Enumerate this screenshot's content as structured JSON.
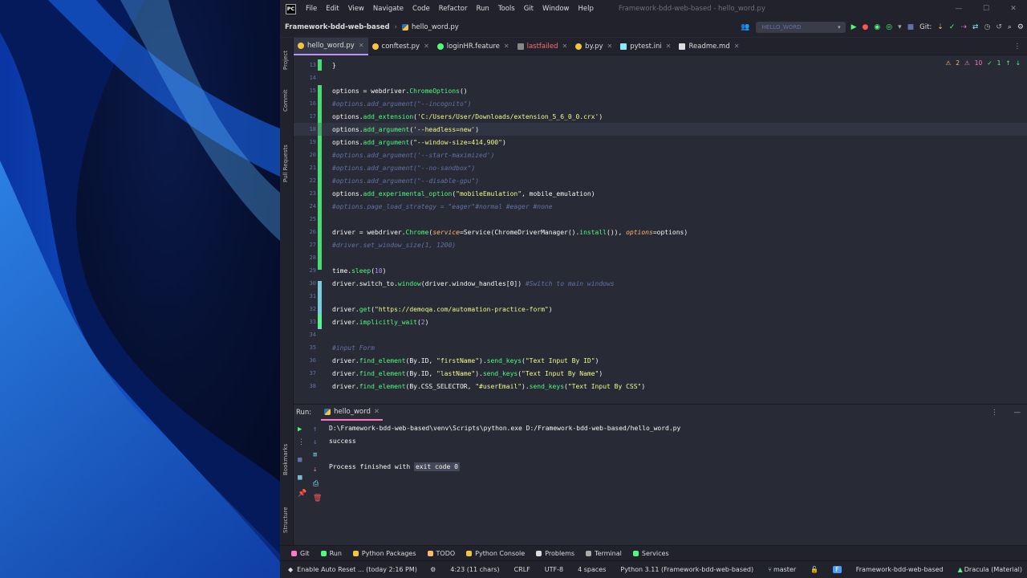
{
  "app": {
    "logo": "PC",
    "menu": [
      "File",
      "Edit",
      "View",
      "Navigate",
      "Code",
      "Refactor",
      "Run",
      "Tools",
      "Git",
      "Window",
      "Help"
    ],
    "window_title": "Framework-bdd-web-based - hello_word.py"
  },
  "navbar": {
    "project": "Framework-bdd-web-based",
    "file": "hello_word.py",
    "run_config": "HELLO_WORD",
    "git_label": "Git:"
  },
  "tabs": [
    {
      "label": "hello_word.py",
      "icon": "python-icon",
      "active": true
    },
    {
      "label": "conftest.py",
      "icon": "python-icon"
    },
    {
      "label": "loginHR.feature",
      "icon": "cucumber-icon"
    },
    {
      "label": "lastfailed",
      "icon": "file-icon",
      "error": true
    },
    {
      "label": "by.py",
      "icon": "python-icon"
    },
    {
      "label": "pytest.ini",
      "icon": "ini-icon"
    },
    {
      "label": "Readme.md",
      "icon": "markdown-icon"
    }
  ],
  "left_toolbar": [
    "Project",
    "Commit",
    "Pull Requests",
    "Bookmarks",
    "Structure"
  ],
  "inspections": {
    "warnings": "2",
    "weak_warnings": "10",
    "typos": "1"
  },
  "code_lines": [
    {
      "n": "13",
      "text": "}"
    },
    {
      "n": "14",
      "text": ""
    },
    {
      "n": "15",
      "text": "options = webdriver.ChromeOptions()"
    },
    {
      "n": "16",
      "text": "#options.add_argument(\"--incognito\")",
      "comment": true
    },
    {
      "n": "17",
      "text": "options.add_extension('C:/Users/User/Downloads/extension_5_6_0_0.crx')"
    },
    {
      "n": "18",
      "text": "options.add_argument('--headless=new')",
      "current": true
    },
    {
      "n": "19",
      "text": "options.add_argument(\"--window-size=414,900\")"
    },
    {
      "n": "20",
      "text": "#options.add_argument('--start-maximized')",
      "comment": true
    },
    {
      "n": "21",
      "text": "#options.add_argument(\"--no-sandbox\")",
      "comment": true
    },
    {
      "n": "22",
      "text": "#options.add_argument(\"--disable-gpu\")",
      "comment": true
    },
    {
      "n": "23",
      "text": "options.add_experimental_option(\"mobileEmulation\", mobile_emulation)"
    },
    {
      "n": "24",
      "text": "#options.page_load_strategy = \"eager\"#normal #eager #none",
      "comment": true
    },
    {
      "n": "25",
      "text": ""
    },
    {
      "n": "26",
      "text": "driver = webdriver.Chrome(service=Service(ChromeDriverManager().install()), options=options)"
    },
    {
      "n": "27",
      "text": "#driver.set_window_size(1, 1200)",
      "comment": true
    },
    {
      "n": "28",
      "text": ""
    },
    {
      "n": "29",
      "text": "time.sleep(10)"
    },
    {
      "n": "30",
      "text": "driver.switch_to.window(driver.window_handles[0]) #Switch to main windows"
    },
    {
      "n": "31",
      "text": ""
    },
    {
      "n": "32",
      "text": "driver.get(\"https://demoqa.com/automation-practice-form\")"
    },
    {
      "n": "33",
      "text": "driver.implicitly_wait(2)"
    },
    {
      "n": "34",
      "text": ""
    },
    {
      "n": "35",
      "text": "#input Form",
      "comment": true
    },
    {
      "n": "36",
      "text": "driver.find_element(By.ID, \"firstName\").send_keys(\"Text Input By ID\")"
    },
    {
      "n": "37",
      "text": "driver.find_element(By.ID, \"lastName\").send_keys(\"Text Input By Name\")"
    },
    {
      "n": "38",
      "text": "driver.find_element(By.CSS_SELECTOR, \"#userEmail\").send_keys(\"Text Input By CSS\")"
    }
  ],
  "run_panel": {
    "label": "Run:",
    "tab": "hello_word",
    "lines": [
      "D:\\Framework-bdd-web-based\\venv\\Scripts\\python.exe D:/Framework-bdd-web-based/hello_word.py",
      "success",
      "",
      "Process finished with "
    ],
    "exit_code": "exit code 0"
  },
  "tool_windows": [
    "Git",
    "Run",
    "Python Packages",
    "TODO",
    "Python Console",
    "Problems",
    "Terminal",
    "Services"
  ],
  "status": {
    "left": "Enable Auto Reset ... (today 2:16 PM)",
    "position": "4:23 (11 chars)",
    "line_sep": "CRLF",
    "encoding": "UTF-8",
    "indent": "4 spaces",
    "interpreter": "Python 3.11 (Framework-bdd-web-based)",
    "branch": "master",
    "project": "Framework-bdd-web-based",
    "theme": "Dracula (Material)"
  },
  "colors": {
    "keyword_fn": "#50fa7b",
    "string": "#f1fa8c",
    "comment": "#6272a4",
    "number": "#bd93f9",
    "param": "#ffb86c",
    "accent": "#bd93f9"
  }
}
